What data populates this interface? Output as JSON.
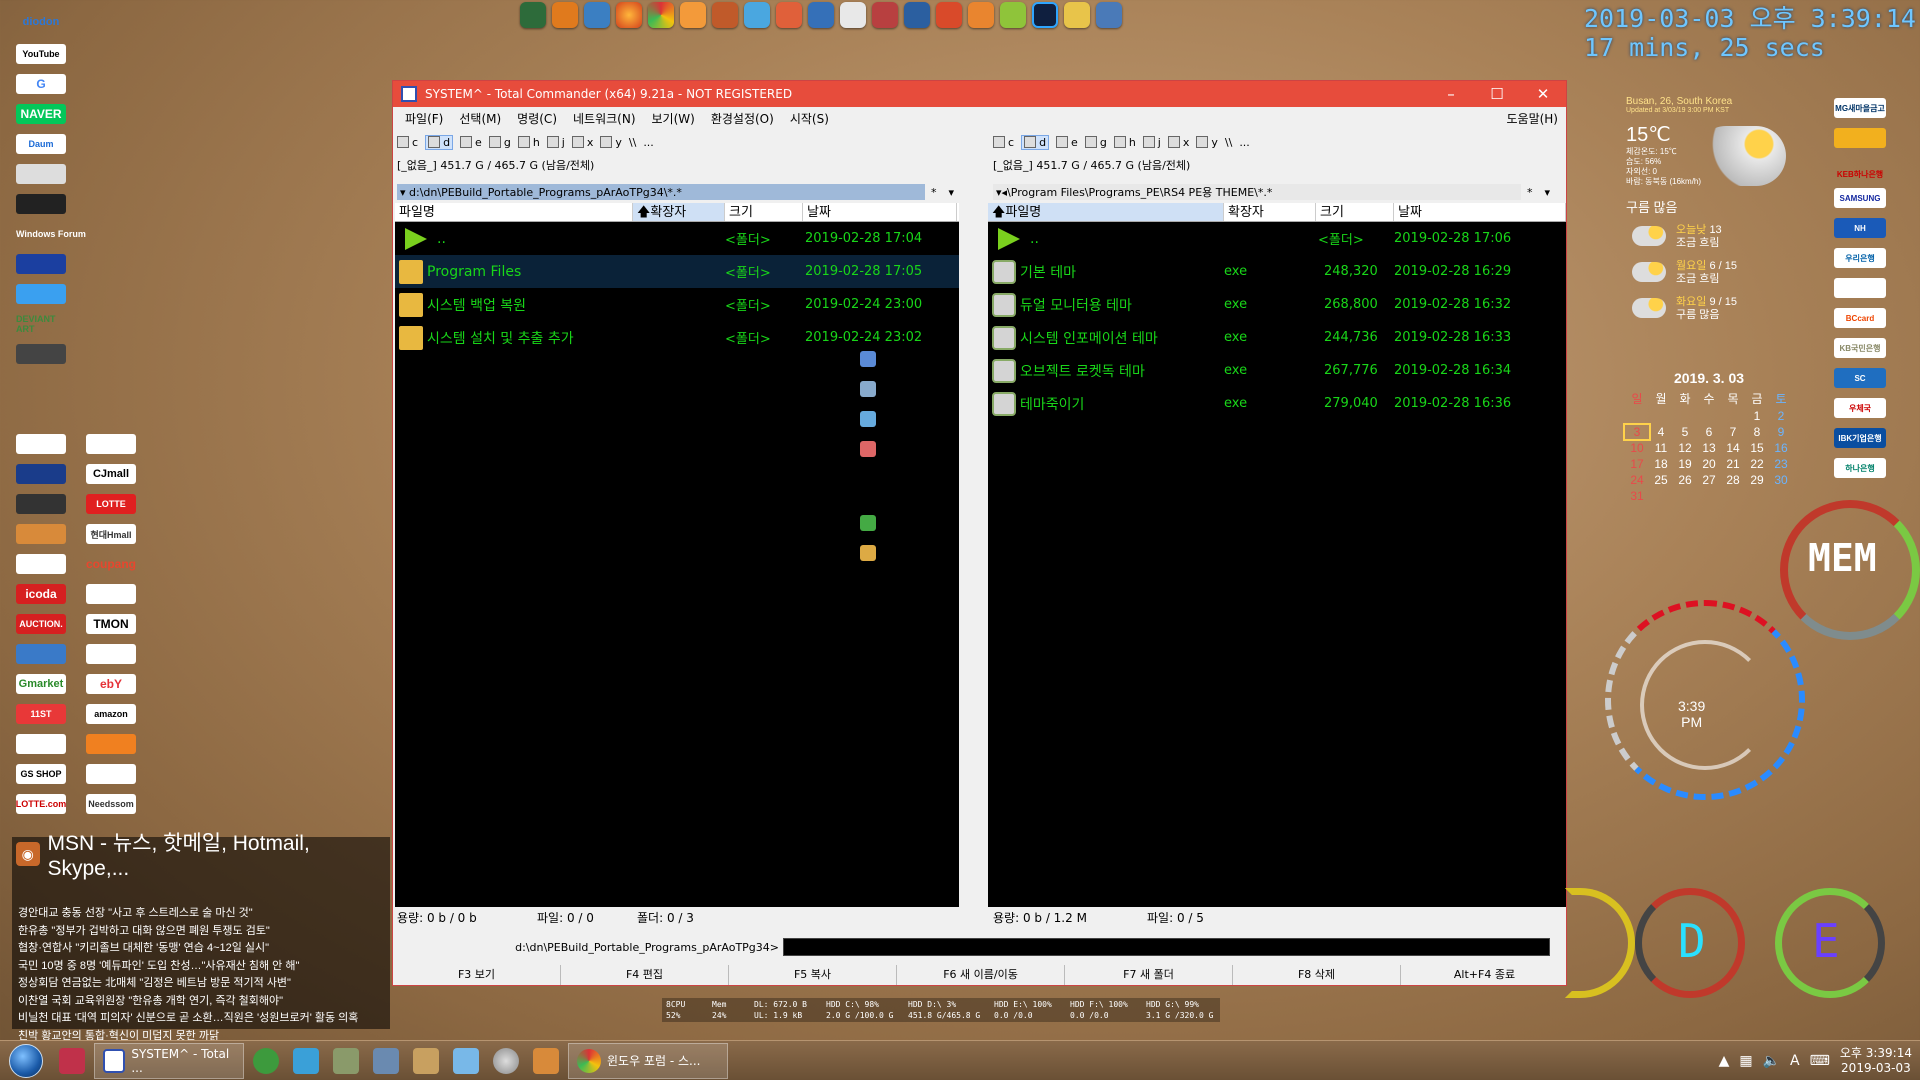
{
  "desktop": {
    "clock_time": "2019-03-03 오후 3:39:14",
    "clock_uptime": "17 mins, 25 secs",
    "left_logos": [
      "YouTube",
      "G",
      "NAVER",
      "Daum",
      "Windows Forum",
      "DEVIANT ART",
      "CJmall",
      "LOTTE",
      "icoda",
      "AUCTION.",
      "TMON",
      "Gmarket",
      "ebY",
      "amazon",
      "GS SHOP",
      "LOTTE.com",
      "Needssom",
      "coupang",
      "현대Hmall",
      "11ST"
    ],
    "msn": {
      "title": "MSN - 뉴스, 핫메일, Hotmail, Skype,...",
      "headlines": [
        "경안대교 충동 선장 \"사고 후 스트레스로 술 마신 것\"",
        "한유총 \"정부가 겁박하고 대화 않으면 폐원 투쟁도 검토\"",
        "협창·연합사 \"키리졸브 대체한 '동맹' 연습 4~12일 실시\"",
        "국민 10명 중 8명 '예듀파인' 도입 찬성…\"사유재산 침해 안 해\"",
        "정상회담 연금없는 北매체 \"김정은 베트남 방문 적기적 사변\"",
        "이찬열 국회 교육위원장 \"한유총 개학 연기, 즉각 철회해야\"",
        "비닐천 대표 '대역 피의자' 신분으로 곧 소환…직원은 '성원브로커' 활동 의혹",
        "친박 황교안의 통합·혁신이 미덥지 못한 까닭"
      ]
    }
  },
  "window": {
    "title": "SYSTEM^ - Total Commander (x64) 9.21a - NOT REGISTERED",
    "menus": [
      "파일(F)",
      "선택(M)",
      "명령(C)",
      "네트워크(N)",
      "보기(W)",
      "환경설정(O)",
      "시작(S)"
    ],
    "help": "도움말(H)",
    "left_drives": [
      "c",
      "d",
      "e",
      "g",
      "h",
      "j",
      "x",
      "y",
      "\\\\",
      "..."
    ],
    "right_drives": [
      "c",
      "d",
      "e",
      "g",
      "h",
      "j",
      "x",
      "y",
      "\\\\",
      "..."
    ],
    "left_free": "[_없음_]  451.7 G / 465.7 G (남음/전체)",
    "right_free": "[_없음_]  451.7 G / 465.7 G (남음/전체)",
    "left_path": "d:\\dn\\PEBuild_Portable_Programs_pArAoTPg34\\*.*",
    "right_path": "\\Program Files\\Programs_PE\\RS4 PE용 THEME\\*.*",
    "columns": {
      "name": "파일명",
      "ext": "확장자",
      "size": "크기",
      "date": "날짜"
    },
    "left_files": [
      {
        "name": "..",
        "ext": "",
        "size": "<폴더>",
        "date": "2019-02-28 17:04",
        "kind": "up"
      },
      {
        "name": "Program Files",
        "ext": "",
        "size": "<폴더>",
        "date": "2019-02-28 17:05",
        "kind": "folder"
      },
      {
        "name": "시스템 백업 복원",
        "ext": "",
        "size": "<폴더>",
        "date": "2019-02-24 23:00",
        "kind": "folder"
      },
      {
        "name": "시스템 설치 및 추출 추가",
        "ext": "",
        "size": "<폴더>",
        "date": "2019-02-24 23:02",
        "kind": "folder"
      }
    ],
    "right_files": [
      {
        "name": "..",
        "ext": "",
        "size": "<폴더>",
        "date": "2019-02-28 17:06",
        "kind": "up"
      },
      {
        "name": "기본 테마",
        "ext": "exe",
        "size": "248,320",
        "date": "2019-02-28 16:29",
        "kind": "exe"
      },
      {
        "name": "듀얼 모니터용 테마",
        "ext": "exe",
        "size": "268,800",
        "date": "2019-02-28 16:32",
        "kind": "exe"
      },
      {
        "name": "시스템 인포메이션 테마",
        "ext": "exe",
        "size": "244,736",
        "date": "2019-02-28 16:33",
        "kind": "exe"
      },
      {
        "name": "오브젝트 로켓독 테마",
        "ext": "exe",
        "size": "267,776",
        "date": "2019-02-28 16:34",
        "kind": "exe"
      },
      {
        "name": "테마죽이기",
        "ext": "exe",
        "size": "279,040",
        "date": "2019-02-28 16:36",
        "kind": "exe"
      }
    ],
    "left_status": {
      "capacity": "용량: 0 b / 0 b",
      "files": "파일: 0 / 0",
      "folders": "폴더: 0 / 3"
    },
    "right_status": {
      "capacity": "용량: 0 b / 1.2 M",
      "files": "파일: 0 / 5"
    },
    "cmd_path": "d:\\dn\\PEBuild_Portable_Programs_pArAoTPg34>",
    "fkeys": [
      "F3 보기",
      "F4 편집",
      "F5 복사",
      "F6 새 이름/이동",
      "F7 새 폴더",
      "F8 삭제",
      "Alt+F4 종료"
    ]
  },
  "weather": {
    "location": "Busan, 26, South Korea",
    "updated": "Updated at 3/03/19 3:00 PM KST",
    "temp": "15℃",
    "details": [
      "체감온도: 15℃",
      "습도: 56%",
      "자외선: 0",
      "바람: 동북동 (16km/h)"
    ],
    "condition": "구름 많음",
    "forecast": [
      {
        "day": "오늘낮",
        "temp": "13",
        "desc": "조금 흐림"
      },
      {
        "day": "월요일",
        "temp": "6 / 15",
        "desc": "조금 흐림"
      },
      {
        "day": "화요일",
        "temp": "9 / 15",
        "desc": "구름 많음"
      }
    ]
  },
  "calendar": {
    "title": "2019. 3. 03",
    "weekdays": [
      "일",
      "월",
      "화",
      "수",
      "목",
      "금",
      "토"
    ],
    "days": [
      "",
      "",
      "",
      "",
      "",
      "1",
      "2",
      "3",
      "4",
      "5",
      "6",
      "7",
      "8",
      "9",
      "10",
      "11",
      "12",
      "13",
      "14",
      "15",
      "16",
      "17",
      "18",
      "19",
      "20",
      "21",
      "22",
      "23",
      "24",
      "25",
      "26",
      "27",
      "28",
      "29",
      "30",
      "31"
    ]
  },
  "banks": [
    "MG새마을금고",
    "",
    "KEB하나은행",
    "SAMSUNG",
    "NH",
    "우리은행",
    "",
    "BCcard",
    "KB국민은행",
    "SC",
    "우체국",
    "IBK기업은행",
    "하나은행"
  ],
  "hud": {
    "time": "3:39",
    "ampm": "PM",
    "mem": "MEM",
    "d": "D",
    "e": "E"
  },
  "perf": {
    "cpu": "8CPU 52%",
    "mem": "Mem 24%",
    "dl": "DL: 672.0 B",
    "ul": "UL: 1.9 kB",
    "hdd": [
      "HDD C:\\ 98% 2.0 G /100.0 G",
      "HDD D:\\ 3% 451.8 G/465.8 G",
      "HDD E:\\ 100% 0.0 /0.0",
      "HDD F:\\ 100% 0.0 /0.0",
      "HDD G:\\ 99% 3.1 G /320.0 G"
    ]
  },
  "taskbar": {
    "task1": "SYSTEM^ - Total ...",
    "task2": "윈도우 포럼 - 스...",
    "time": "오후 3:39:14",
    "date": "2019-03-03",
    "ime": "A"
  },
  "colors": {
    "titlebar": "#e74c3c",
    "file_text": "#19d619",
    "panel_bg": "#000000",
    "clock": "#6ec6ff"
  }
}
